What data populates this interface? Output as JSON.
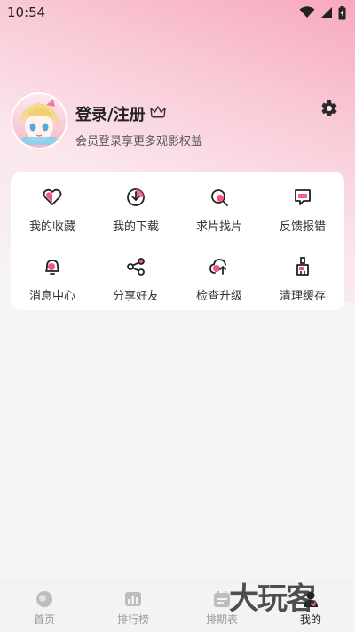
{
  "status_bar": {
    "time": "10:54",
    "icons": [
      "wifi-icon",
      "signal-icon",
      "battery-charging-icon"
    ]
  },
  "profile": {
    "username": "登录/注册",
    "subtitle": "会员登录享更多观影权益",
    "avatar": "anime-avatar",
    "vip_icon": "crown-icon",
    "settings_icon": "gear-icon"
  },
  "features": [
    {
      "label": "我的收藏",
      "icon": "heart-icon"
    },
    {
      "label": "我的下载",
      "icon": "download-icon"
    },
    {
      "label": "求片找片",
      "icon": "search-icon"
    },
    {
      "label": "反馈报错",
      "icon": "feedback-icon"
    },
    {
      "label": "消息中心",
      "icon": "bell-icon"
    },
    {
      "label": "分享好友",
      "icon": "share-icon"
    },
    {
      "label": "检查升级",
      "icon": "upgrade-icon"
    },
    {
      "label": "清理缓存",
      "icon": "broom-icon"
    }
  ],
  "tabbar": {
    "items": [
      {
        "label": "首页",
        "icon": "home-icon"
      },
      {
        "label": "排行榜",
        "icon": "ranking-icon"
      },
      {
        "label": "排期表",
        "icon": "calendar-icon"
      },
      {
        "label": "我的",
        "icon": "profile-icon"
      }
    ],
    "active_index": 3
  },
  "watermark": "大玩客",
  "colors": {
    "accent": "#f0577b",
    "gradient_top": "#f7a8bf",
    "background": "#f5f5f7"
  }
}
